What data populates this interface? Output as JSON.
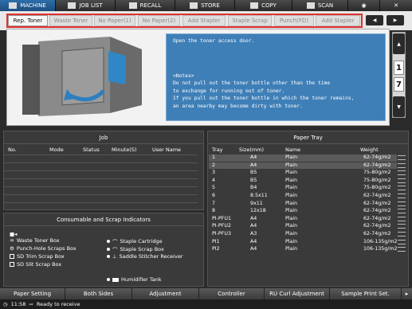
{
  "nav": {
    "machine": "MACHINE",
    "job_list": "JOB LIST",
    "recall": "RECALL",
    "store": "STORE",
    "copy": "COPY",
    "scan": "SCAN"
  },
  "tabs": [
    "Rep. Toner",
    "Waste Toner",
    "No Paper(1)",
    "No Paper(2)",
    "Add Stapler",
    "Staple Scrap",
    "Punch(FD)",
    "Add Stapler"
  ],
  "message": {
    "line1": "Open the toner access door.",
    "notes_title": "<Notes>",
    "note1": "Do not pull out the toner bottle other than the time",
    "note2": "to exchange for running out of toner.",
    "note3": "If you pull out the toner bottle in which the toner remains,",
    "note4": "an area nearby may become dirty with toner."
  },
  "side": {
    "num_top": "1",
    "num_bottom": "7"
  },
  "job": {
    "title": "Job",
    "columns": [
      "No.",
      "Mode",
      "Status",
      "Minute(S)",
      "User Name"
    ]
  },
  "consumables": {
    "title": "Consumable and Scrap Indicators",
    "left": [
      "Waste Toner Box",
      "Punch-Hole Scraps Box",
      "SD Trim Scrap Box",
      "SD Slit Scrap Box"
    ],
    "right": [
      "Staple Cartridge",
      "Staple Scrap Box",
      "Saddle Stitcher Receiver"
    ],
    "humidifier": "Humidifier Tank"
  },
  "tray": {
    "title": "Paper Tray",
    "columns": [
      "Tray",
      "Size(mm)",
      "Name",
      "Weight"
    ],
    "rows": [
      {
        "tray": "1",
        "size": "A4",
        "name": "Plain",
        "weight": "62-74g/m2"
      },
      {
        "tray": "2",
        "size": "A4",
        "name": "Plain",
        "weight": "62-74g/m2"
      },
      {
        "tray": "3",
        "size": "B5",
        "name": "Plain",
        "weight": "75-80g/m2"
      },
      {
        "tray": "4",
        "size": "B5",
        "name": "Plain",
        "weight": "75-80g/m2"
      },
      {
        "tray": "5",
        "size": "B4",
        "name": "Plain",
        "weight": "75-80g/m2"
      },
      {
        "tray": "6",
        "size": "8.5x11",
        "name": "Plain",
        "weight": "62-74g/m2"
      },
      {
        "tray": "7",
        "size": "9x11",
        "name": "Plain",
        "weight": "62-74g/m2"
      },
      {
        "tray": "8",
        "size": "12x18",
        "name": "Plain",
        "weight": "62-74g/m2"
      },
      {
        "tray": "PI-PFU1",
        "size": "A4",
        "name": "Plain",
        "weight": "62-74g/m2"
      },
      {
        "tray": "PI-PFU2",
        "size": "A4",
        "name": "Plain",
        "weight": "62-74g/m2"
      },
      {
        "tray": "PI-PFU3",
        "size": "A3",
        "name": "Plain",
        "weight": "62-74g/m2"
      },
      {
        "tray": "PI1",
        "size": "A4",
        "name": "Plain",
        "weight": "106-135g/m2"
      },
      {
        "tray": "PI2",
        "size": "A4",
        "name": "Plain",
        "weight": "106-135g/m2"
      }
    ]
  },
  "bottom": [
    "Paper Setting",
    "Both Sides",
    "Adjustment",
    "Controller",
    "RU Curl Adjustment",
    "Sample Print Set."
  ],
  "status": {
    "time": "11:58",
    "text": "Ready to receive"
  }
}
